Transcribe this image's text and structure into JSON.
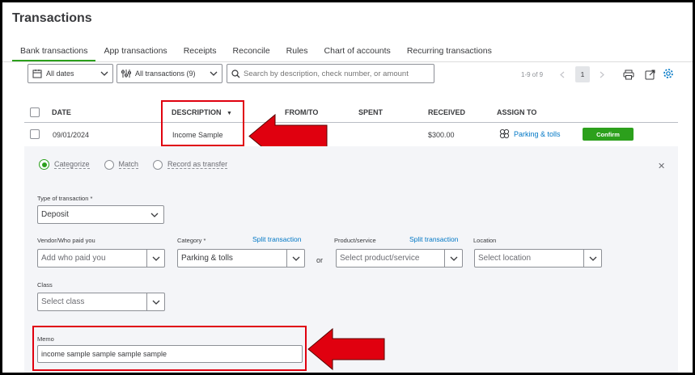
{
  "page": {
    "title": "Transactions"
  },
  "tabs": [
    {
      "label": "Bank transactions"
    },
    {
      "label": "App transactions"
    },
    {
      "label": "Receipts"
    },
    {
      "label": "Reconcile"
    },
    {
      "label": "Rules"
    },
    {
      "label": "Chart of accounts"
    },
    {
      "label": "Recurring transactions"
    }
  ],
  "filters": {
    "dates_label": "All dates",
    "transactions_label": "All transactions (9)",
    "search_placeholder": "Search by description, check number, or amount"
  },
  "pagination": {
    "range": "1-9 of 9",
    "current_page": "1"
  },
  "table": {
    "headers": {
      "date": "DATE",
      "description": "DESCRIPTION",
      "from_to": "FROM/TO",
      "spent": "SPENT",
      "received": "RECEIVED",
      "assign_to": "ASSIGN TO"
    },
    "row": {
      "date": "09/01/2024",
      "description": "Income Sample",
      "from_to": "",
      "spent": "",
      "received": "$300.00",
      "assign_to": "Parking & tolls",
      "action": "Confirm"
    }
  },
  "detail": {
    "mode_options": [
      "Categorize",
      "Match",
      "Record as transfer"
    ],
    "selected_mode": "Categorize",
    "type_label": "Type of transaction *",
    "type_value": "Deposit",
    "vendor_label": "Vendor/Who paid you",
    "vendor_placeholder": "Add who paid you",
    "category_label": "Category *",
    "category_split_link": "Split transaction",
    "category_value": "Parking & tolls",
    "or_text": "or",
    "product_label": "Product/service",
    "product_split_link": "Split transaction",
    "product_placeholder": "Select product/service",
    "location_label": "Location",
    "location_placeholder": "Select location",
    "class_label": "Class",
    "class_placeholder": "Select class",
    "memo_label": "Memo",
    "memo_value": "income sample sample sample sample"
  },
  "colors": {
    "accent_green": "#2ca01c",
    "confirm_green": "#2ca01c",
    "link_blue": "#0077c5",
    "highlight_red": "#e0000f"
  },
  "icons": [
    "calendar-icon",
    "chevron-down-icon",
    "filter-sliders-icon",
    "search-icon",
    "chevron-left-icon",
    "chevron-right-icon",
    "print-icon",
    "export-icon",
    "gear-icon",
    "category-icon",
    "close-icon",
    "arrow-left-icon"
  ]
}
